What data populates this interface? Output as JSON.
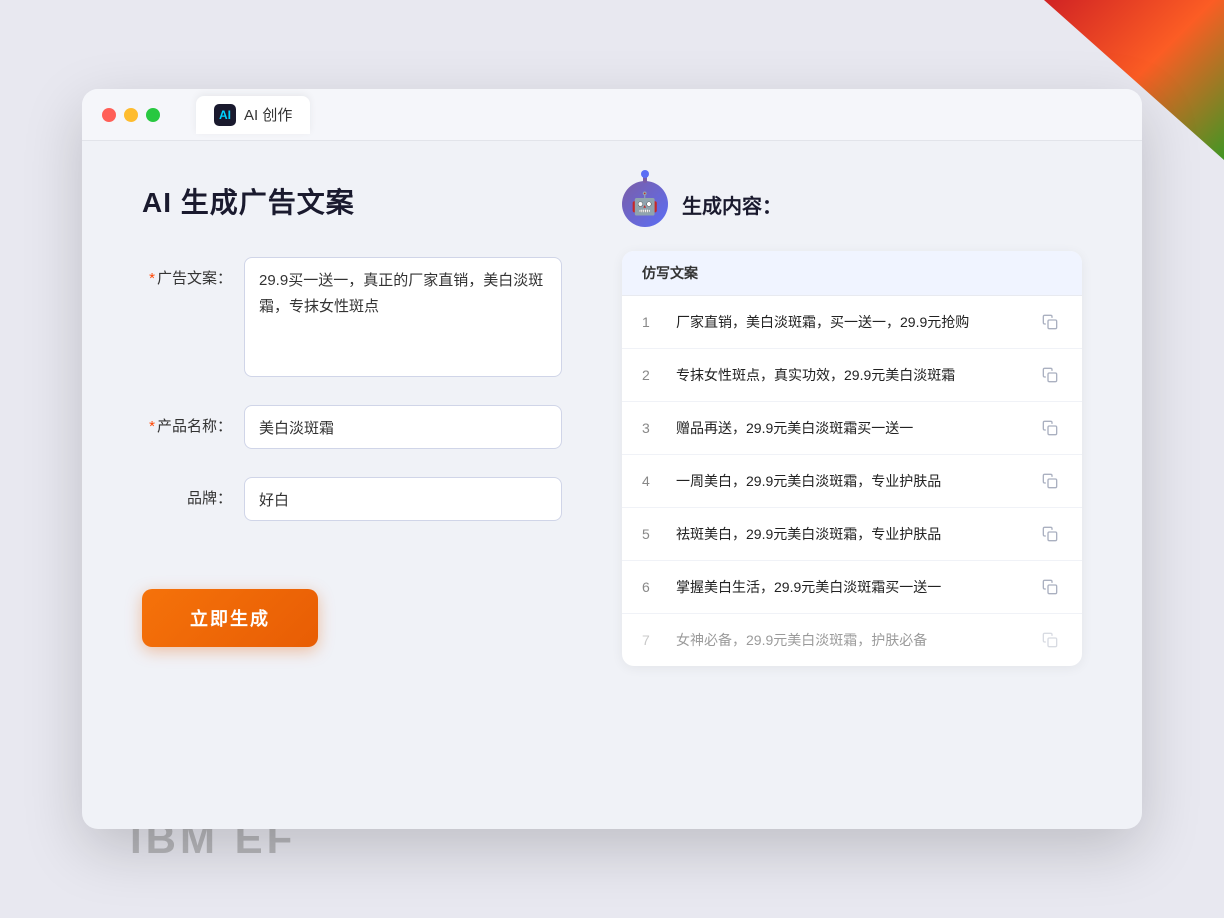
{
  "decorative": {
    "ibm_ef": "IBM EF"
  },
  "browser": {
    "tab_icon": "AI",
    "tab_title": "AI 创作"
  },
  "left_panel": {
    "page_title": "AI 生成广告文案",
    "fields": {
      "ad_copy_label": "广告文案：",
      "ad_copy_required": "*",
      "ad_copy_value": "29.9买一送一，真正的厂家直销，美白淡斑霜，专抹女性斑点",
      "product_name_label": "产品名称：",
      "product_name_required": "*",
      "product_name_value": "美白淡斑霜",
      "brand_label": "品牌：",
      "brand_value": "好白"
    },
    "generate_button": "立即生成"
  },
  "right_panel": {
    "title": "生成内容：",
    "column_header": "仿写文案",
    "results": [
      {
        "num": "1",
        "text": "厂家直销，美白淡斑霜，买一送一，29.9元抢购",
        "faded": false
      },
      {
        "num": "2",
        "text": "专抹女性斑点，真实功效，29.9元美白淡斑霜",
        "faded": false
      },
      {
        "num": "3",
        "text": "赠品再送，29.9元美白淡斑霜买一送一",
        "faded": false
      },
      {
        "num": "4",
        "text": "一周美白，29.9元美白淡斑霜，专业护肤品",
        "faded": false
      },
      {
        "num": "5",
        "text": "祛斑美白，29.9元美白淡斑霜，专业护肤品",
        "faded": false
      },
      {
        "num": "6",
        "text": "掌握美白生活，29.9元美白淡斑霜买一送一",
        "faded": false
      },
      {
        "num": "7",
        "text": "女神必备，29.9元美白淡斑霜，护肤必备",
        "faded": true
      }
    ]
  }
}
